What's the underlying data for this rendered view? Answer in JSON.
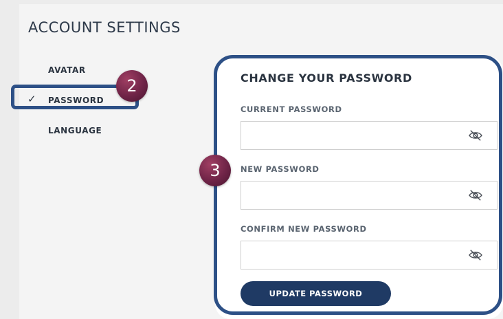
{
  "page": {
    "title": "ACCOUNT SETTINGS"
  },
  "sidebar": {
    "items": [
      {
        "label": "AVATAR",
        "active": false
      },
      {
        "label": "PASSWORD",
        "active": true
      },
      {
        "label": "LANGUAGE",
        "active": false
      }
    ]
  },
  "callouts": {
    "step_sidebar": "2",
    "step_form": "3"
  },
  "form": {
    "title": "CHANGE YOUR PASSWORD",
    "fields": [
      {
        "label": "CURRENT PASSWORD",
        "value": "",
        "icon": "eye-slash-icon"
      },
      {
        "label": "NEW PASSWORD",
        "value": "",
        "icon": "eye-slash-icon"
      },
      {
        "label": "CONFIRM NEW PASSWORD",
        "value": "",
        "icon": "eye-slash-icon"
      }
    ],
    "submit_label": "UPDATE PASSWORD"
  },
  "colors": {
    "accent": "#2d5086",
    "button": "#1f3a64",
    "badge": "#6f2447"
  }
}
